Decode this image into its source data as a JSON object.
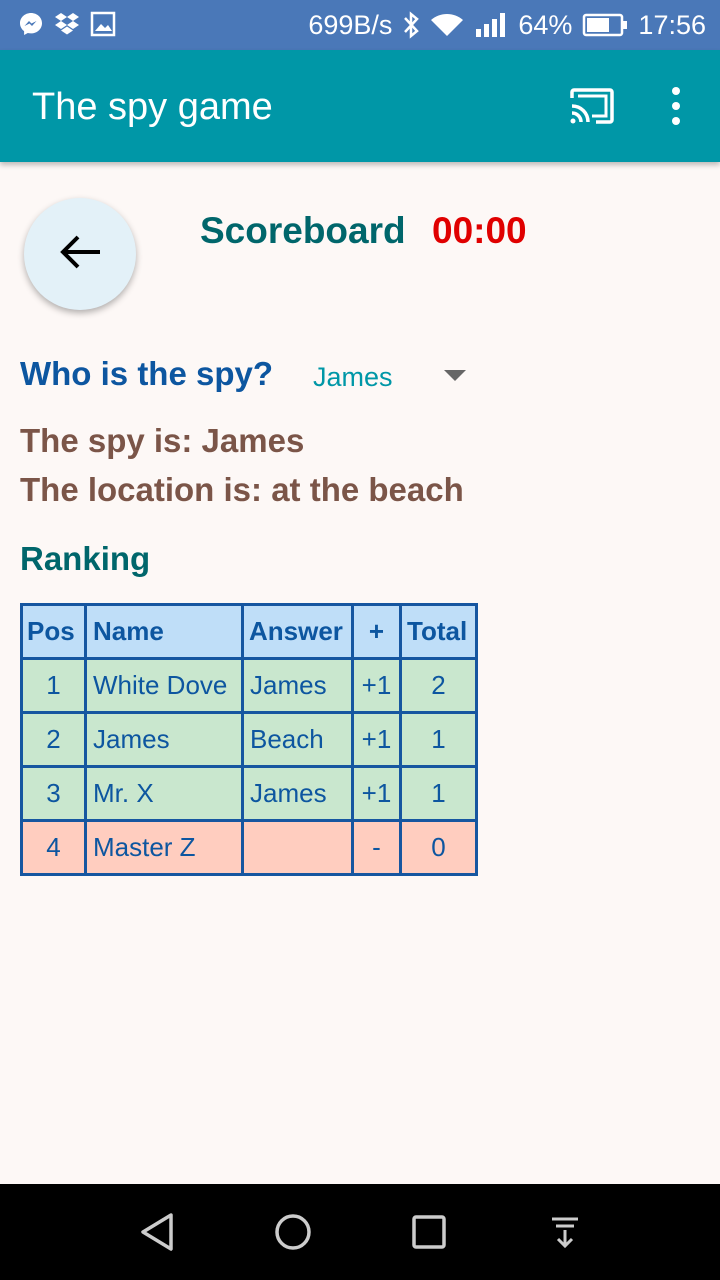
{
  "status_bar": {
    "net_speed": "699B/s",
    "battery": "64%",
    "time": "17:56",
    "icons": [
      "messenger-icon",
      "dropbox-icon",
      "image-icon",
      "bluetooth-icon",
      "wifi-icon",
      "signal-icon",
      "battery-icon"
    ]
  },
  "app_bar": {
    "title": "The spy game",
    "icons": [
      "cast-icon",
      "more-vert-icon"
    ]
  },
  "header": {
    "title": "Scoreboard",
    "timer": "00:00"
  },
  "question": {
    "label": "Who is the spy?",
    "selected": "James"
  },
  "result": {
    "spy_line": "The spy is: James",
    "location_line": "The location is: at the beach"
  },
  "ranking": {
    "title": "Ranking",
    "columns": [
      "Pos",
      "Name",
      "Answer",
      "+",
      "Total"
    ],
    "rows": [
      {
        "pos": "1",
        "name": "White Dove",
        "answer": "James",
        "plus": "+1",
        "total": "2"
      },
      {
        "pos": "2",
        "name": "James",
        "answer": "Beach",
        "plus": "+1",
        "total": "1"
      },
      {
        "pos": "3",
        "name": "Mr. X",
        "answer": "James",
        "plus": "+1",
        "total": "1"
      },
      {
        "pos": "4",
        "name": "Master Z",
        "answer": "",
        "plus": "-",
        "total": "0"
      }
    ]
  },
  "colors": {
    "app_bar": "#0097a7",
    "status_bar": "#4a78b8",
    "timer": "#e00000",
    "correct_row": "#c9e7ce",
    "wrong_row": "#ffcdbf",
    "header_row": "#bfdef8"
  }
}
